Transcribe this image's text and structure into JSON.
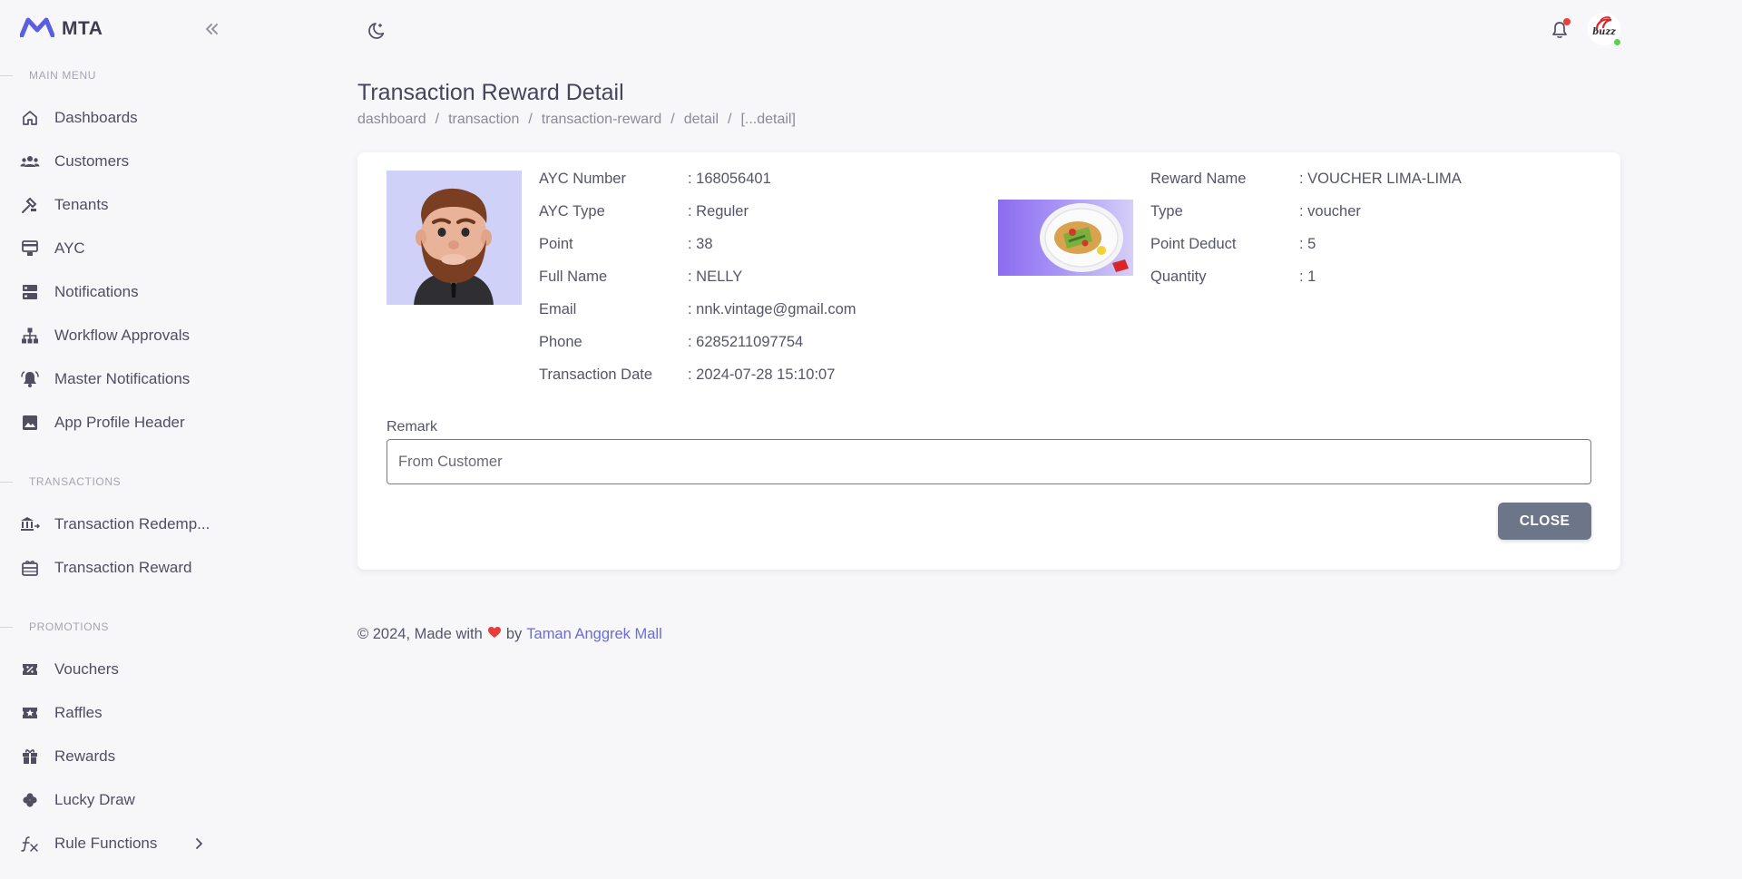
{
  "brand": {
    "name": "MTA"
  },
  "sidebar": {
    "sections": {
      "main": "MAIN MENU",
      "transactions": "TRANSACTIONS",
      "promotions": "PROMOTIONS"
    },
    "items": [
      {
        "label": "Dashboards",
        "icon": "home-icon"
      },
      {
        "label": "Customers",
        "icon": "users-icon"
      },
      {
        "label": "Tenants",
        "icon": "tenants-icon"
      },
      {
        "label": "AYC",
        "icon": "card-reader-icon"
      },
      {
        "label": "Notifications",
        "icon": "server-icon"
      },
      {
        "label": "Workflow Approvals",
        "icon": "sitemap-icon"
      },
      {
        "label": "Master Notifications",
        "icon": "bell-ring-icon"
      },
      {
        "label": "App Profile Header",
        "icon": "image-icon"
      },
      {
        "label": "Transaction Redemp...",
        "icon": "bank-transfer-icon"
      },
      {
        "label": "Transaction Reward",
        "icon": "gift-card-icon"
      },
      {
        "label": "Vouchers",
        "icon": "ticket-percent-icon"
      },
      {
        "label": "Raffles",
        "icon": "ticket-star-icon"
      },
      {
        "label": "Rewards",
        "icon": "gift-icon"
      },
      {
        "label": "Lucky Draw",
        "icon": "clover-icon"
      },
      {
        "label": "Rule Functions",
        "icon": "function-icon"
      }
    ]
  },
  "page": {
    "title": "Transaction Reward Detail",
    "breadcrumb": [
      "dashboard",
      "transaction",
      "transaction-reward",
      "detail",
      "[...detail]"
    ]
  },
  "customer": {
    "rows": [
      {
        "label": "AYC Number",
        "value": ": 168056401"
      },
      {
        "label": "AYC Type",
        "value": ": Reguler"
      },
      {
        "label": "Point",
        "value": ": 38"
      },
      {
        "label": "Full Name",
        "value": ": NELLY"
      },
      {
        "label": "Email",
        "value": ": nnk.vintage@gmail.com"
      },
      {
        "label": "Phone",
        "value": ": 6285211097754"
      },
      {
        "label": "Transaction Date",
        "value": ": 2024-07-28 15:10:07"
      }
    ]
  },
  "reward": {
    "rows": [
      {
        "label": "Reward Name",
        "value": ": VOUCHER LIMA-LIMA"
      },
      {
        "label": "Type",
        "value": ": voucher"
      },
      {
        "label": "Point Deduct",
        "value": ": 5"
      },
      {
        "label": "Quantity",
        "value": ": 1"
      }
    ]
  },
  "remark": {
    "label": "Remark",
    "value": "From Customer"
  },
  "actions": {
    "close": "CLOSE"
  },
  "footer": {
    "prefix": "© 2024, Made with",
    "by": "by",
    "link": "Taman Anggrek Mall"
  },
  "colors": {
    "accent": "#6a6cd8",
    "brand": "#5a5fe0",
    "close_button": "#6d7689",
    "notification_dot": "#ea4040"
  }
}
